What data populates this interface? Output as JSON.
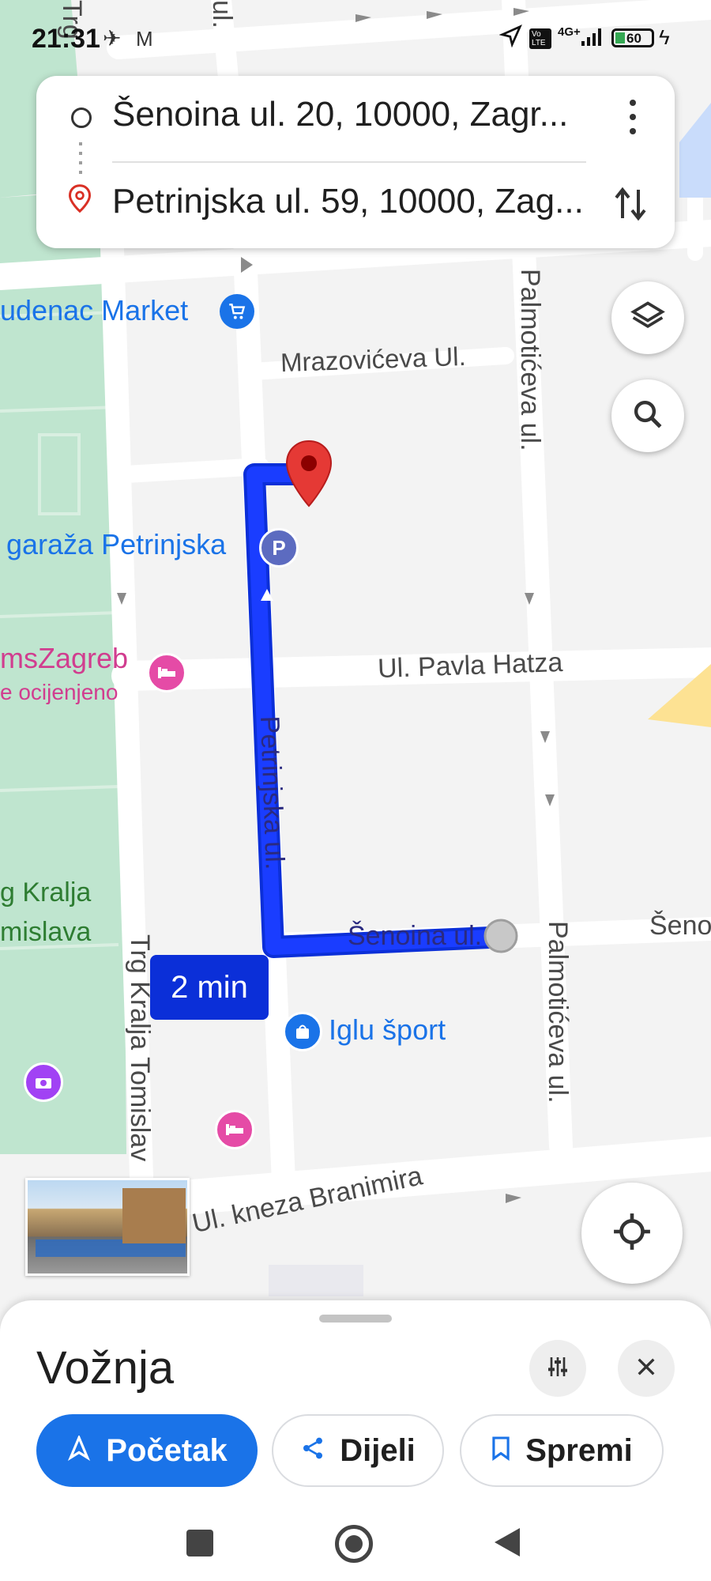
{
  "status_bar": {
    "time": "21:31",
    "network": "4G+",
    "volte": "Vo LTE",
    "battery": "60"
  },
  "directions": {
    "origin": "Šenoina ul. 20, 10000, Zagr...",
    "destination": "Petrinjska ul. 59, 10000, Zag..."
  },
  "map": {
    "streets": {
      "mrazoviceva": "Mrazovićeva Ul.",
      "palmoticeva": "Palmotićeva ul.",
      "palmoticeva2": "Palmotićeva ul.",
      "pavla_hatza": "Ul. Pavla Hatza",
      "petrinjska": "Petrinjska ul.",
      "senoina": "Šenoina ul.",
      "senoina_right": "Šeno",
      "trg_kralja": "Trg Kralja Tomislav",
      "kneza_branimira": "Ul. kneza Branimira",
      "trg_top": "Trg",
      "ul_top": "ul."
    },
    "pois": {
      "market": "udenac Market",
      "garage": "garaža Petrinjska",
      "hotel_name": "msZagreb",
      "hotel_sub": "e ocijenjeno",
      "iglu": "Iglu šport"
    },
    "park": {
      "line1": "g Kralja",
      "line2": "mislava"
    },
    "route_duration": "2 min",
    "route_color": "#1a3dff",
    "duration_bg": "#0b2fd8"
  },
  "sheet": {
    "title": "Vožnja",
    "start_label": "Početak",
    "share_label": "Dijeli",
    "save_label": "Spremi",
    "accent": "#1a73e8"
  },
  "icons": {
    "options": "more-vert-icon",
    "swap": "swap-icon",
    "layers": "layers-icon",
    "search": "search-icon",
    "location": "my-location-icon",
    "filter": "tune-icon",
    "close": "close-icon"
  }
}
